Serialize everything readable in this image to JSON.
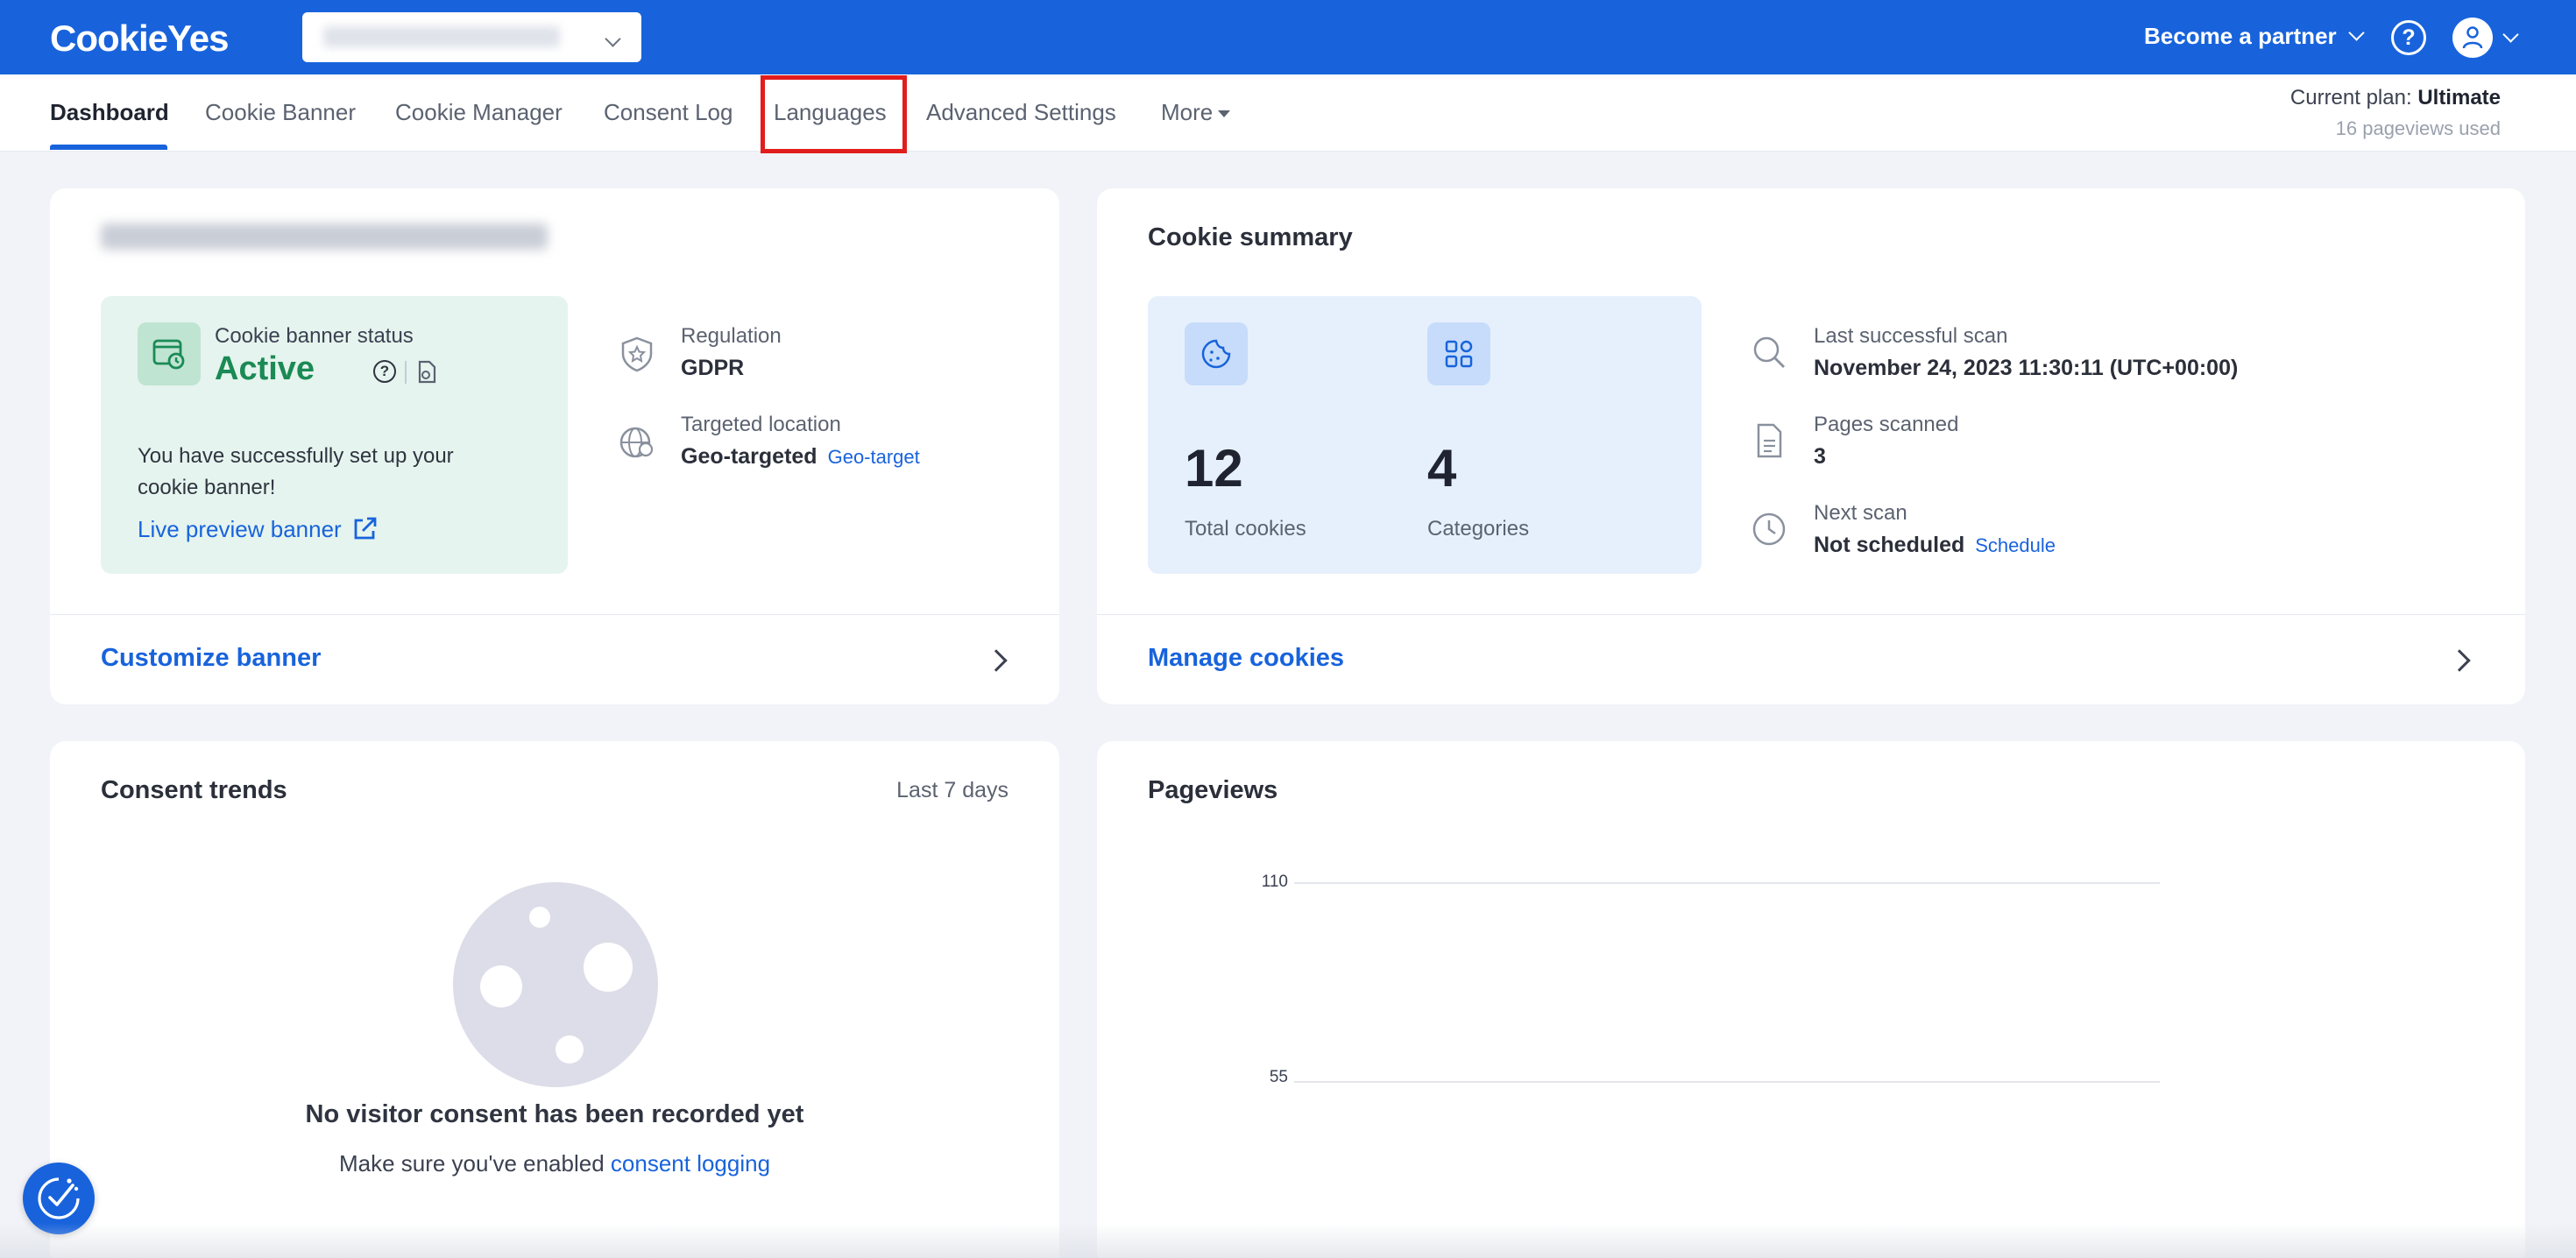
{
  "header": {
    "logo": "CookieYes",
    "site_selector_value": "",
    "partner_label": "Become a partner",
    "help_icon": "?"
  },
  "nav": {
    "tabs": [
      {
        "label": "Dashboard",
        "active": true
      },
      {
        "label": "Cookie Banner"
      },
      {
        "label": "Cookie Manager"
      },
      {
        "label": "Consent Log"
      },
      {
        "label": "Languages",
        "highlighted": true
      },
      {
        "label": "Advanced Settings"
      },
      {
        "label": "More"
      }
    ],
    "plan_label": "Current plan:",
    "plan_name": "Ultimate",
    "pageviews_used": "16 pageviews used"
  },
  "banner_card": {
    "site_url": "",
    "status_label": "Cookie banner status",
    "status_value": "Active",
    "message": "You have successfully set up your cookie banner!",
    "live_preview": "Live preview banner",
    "regulation_label": "Regulation",
    "regulation_value": "GDPR",
    "location_label": "Targeted location",
    "location_value": "Geo-targeted",
    "location_link": "Geo-target",
    "footer_link": "Customize banner"
  },
  "cookie_summary": {
    "title": "Cookie summary",
    "total_cookies": "12",
    "total_cookies_label": "Total cookies",
    "categories": "4",
    "categories_label": "Categories",
    "last_scan_label": "Last successful scan",
    "last_scan_value": "November 24, 2023 11:30:11  (UTC+00:00)",
    "pages_label": "Pages scanned",
    "pages_value": "3",
    "next_scan_label": "Next scan",
    "next_scan_value": "Not scheduled",
    "schedule_link": "Schedule",
    "footer_link": "Manage cookies"
  },
  "consent_trends": {
    "title": "Consent trends",
    "range": "Last 7 days",
    "empty_heading": "No visitor consent has been recorded yet",
    "empty_sub": "Make sure you've enabled",
    "empty_link": "consent logging"
  },
  "pageviews": {
    "title": "Pageviews",
    "tick_110": "110",
    "tick_55": "55"
  },
  "colors": {
    "brand": "#1863dc",
    "active_green": "#1b8a55",
    "highlight_red": "#e21d1d"
  }
}
